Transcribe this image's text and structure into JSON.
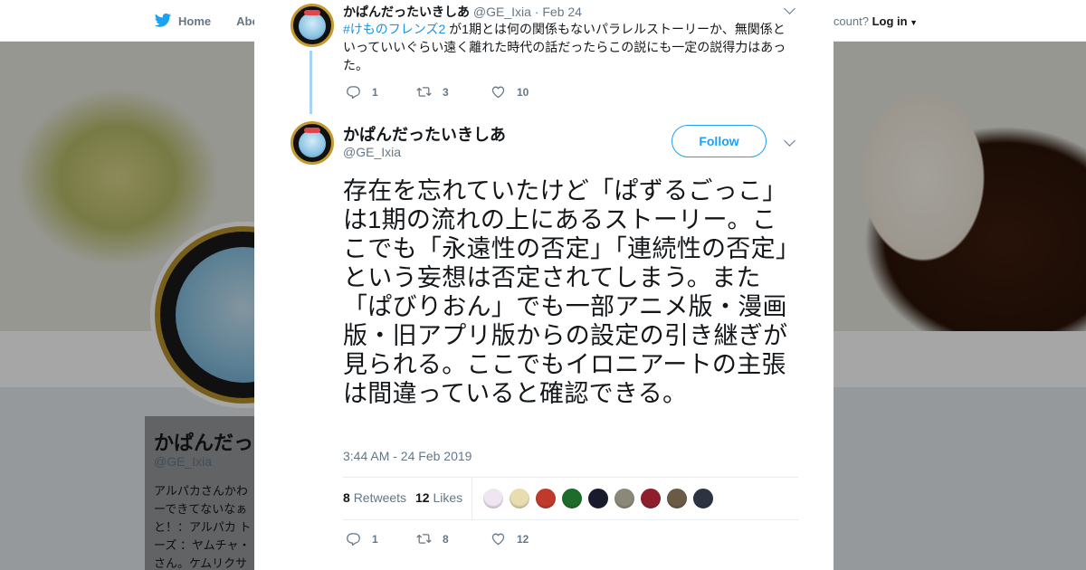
{
  "background": {
    "nav": {
      "home": "Home",
      "about": "Abo"
    },
    "account_prompt": "ccount?",
    "login": "Log in",
    "profile_name": "かぱんだっ",
    "profile_handle": "@GE_Ixia",
    "bio_lines": [
      "アルパカさんかわ",
      "ーできてないなぁ",
      "と！：アルパカ ト",
      "ーズ ：ヤムチャ・",
      "さん。ケムリクサ"
    ]
  },
  "close_icon": "close-icon",
  "tweet_parent": {
    "name": "かぱんだったいきしあ",
    "handle": "@GE_Ixia",
    "separator": "·",
    "date": "Feb 24",
    "hashtag": "#けものフレンズ2",
    "text": " が1期とは何の関係もないパラレルストーリーか、無関係といっていいぐらい遠く離れた時代の話だったらこの説にも一定の説得力はあった。",
    "replies": "1",
    "retweets": "3",
    "likes": "10"
  },
  "tweet_main": {
    "name": "かぱんだったいきしあ",
    "handle": "@GE_Ixia",
    "follow_label": "Follow",
    "text": "存在を忘れていたけど「ぱずるごっこ」は1期の流れの上にあるストーリー。ここでも「永遠性の否定」「連続性の否定」という妄想は否定されてしまう。また「ぱびりおん」でも一部アニメ版・漫画版・旧アプリ版からの設定の引き継ぎが見られる。ここでもイロニアートの主張は間違っていると確認できる。",
    "timestamp": "3:44 AM - 24 Feb 2019",
    "retweet_count": "8",
    "retweet_label": "Retweets",
    "like_count": "12",
    "like_label": "Likes",
    "liker_colors": [
      "#efe6f2",
      "#e8dcb0",
      "#c0392b",
      "#1e6b2b",
      "#1a1a2e",
      "#8a8878",
      "#8e1f2a",
      "#6b5a44",
      "#2d3340"
    ],
    "replies": "1",
    "retweets": "8",
    "likes": "12"
  },
  "colors": {
    "accent": "#1da1f2",
    "hashtag": "#1b95e0",
    "muted": "#657786",
    "thread_line": "#a6d4f2"
  }
}
